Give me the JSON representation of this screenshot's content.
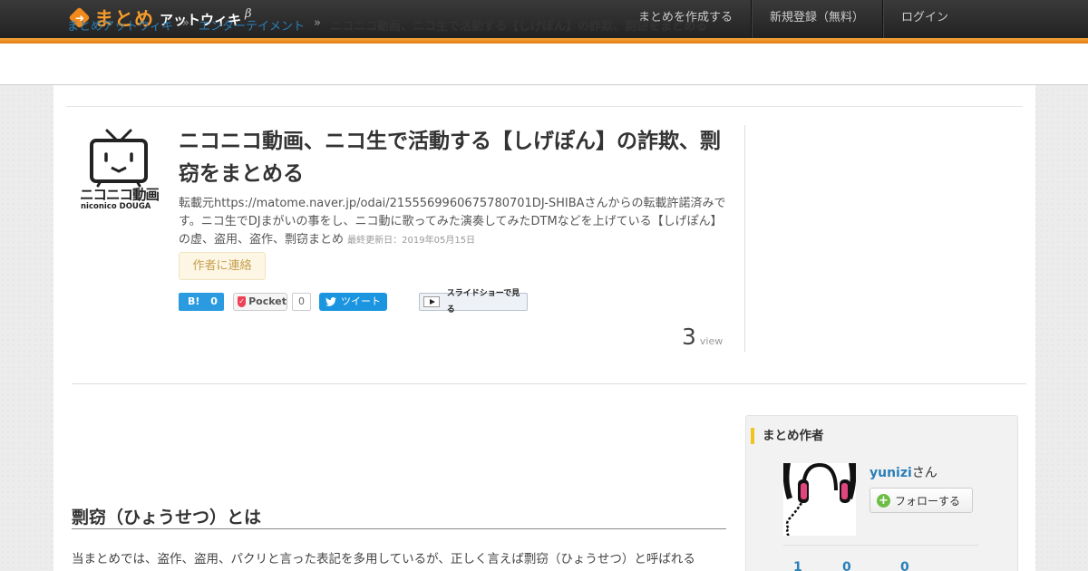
{
  "header": {
    "logo_main": "まとめ",
    "logo_sub": "アットウィキ",
    "logo_beta": "β",
    "nav": [
      "まとめを作成する",
      "新規登録（無料）",
      "ログイン"
    ]
  },
  "breadcrumb": {
    "items": [
      "まとめアットウィキ",
      "エンターテイメント"
    ],
    "separator": "»",
    "current": "ニコニコ動画、ニコ生で活動する【しげぽん】の詐欺、剽窃をまとめる"
  },
  "article": {
    "thumbnail_text": [
      "ニコニコ動画",
      "niconico DOUGA"
    ],
    "title": "ニコニコ動画、ニコ生で活動する【しげぽん】の詐欺、剽窃をまとめる",
    "description": "転載元https://matome.naver.jp/odai/2155569960675780701DJ-SHIBAさんからの転載許諾済みです。ニコ生でDJまがいの事をし、ニコ動に歌ってみた演奏してみたDTMなどを上げている【しげぽん】の虚、盗用、盗作、剽窃まとめ",
    "updated": "最終更新日：2019年05月15日",
    "contact_label": "作者に連絡",
    "share": {
      "hatena_label": "B!",
      "hatena_count": "0",
      "pocket_label": "Pocket",
      "pocket_count": "0",
      "tweet_label": "ツイート",
      "slideshow_label": "スライドショーで見る"
    },
    "views": {
      "count": "3",
      "label": "view"
    },
    "section_heading": "剽窃（ひょうせつ）とは",
    "section_text": "当まとめでは、盗作、盗用、パクリと言った表記を多用しているが、正しく言えば剽窃（ひょうせつ）と呼ばれる"
  },
  "sidebar": {
    "heading": "まとめ作者",
    "author_name": "yunizi",
    "author_suffix": "さん",
    "follow_label": "フォローする",
    "stats": [
      "1",
      "0",
      "0"
    ]
  },
  "colors": {
    "accent_orange": "#f49b2c",
    "link_blue": "#2a7fb8",
    "hatena_blue": "#2a9be0",
    "twitter_blue": "#1b95e0",
    "pocket_red": "#ef4056"
  }
}
